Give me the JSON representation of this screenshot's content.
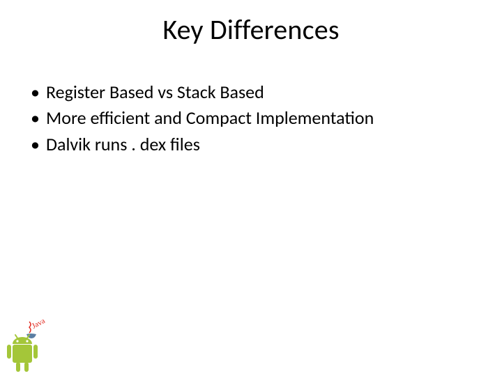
{
  "title": "Key Differences",
  "bullets": [
    "Register Based vs Stack Based",
    "More efficient and Compact Implementation",
    "Dalvik runs . dex files"
  ],
  "corner_icon": {
    "name": "android-java-icon",
    "android_color": "#A4C639",
    "java_text": "Java",
    "java_text_color": "#E1261C"
  }
}
